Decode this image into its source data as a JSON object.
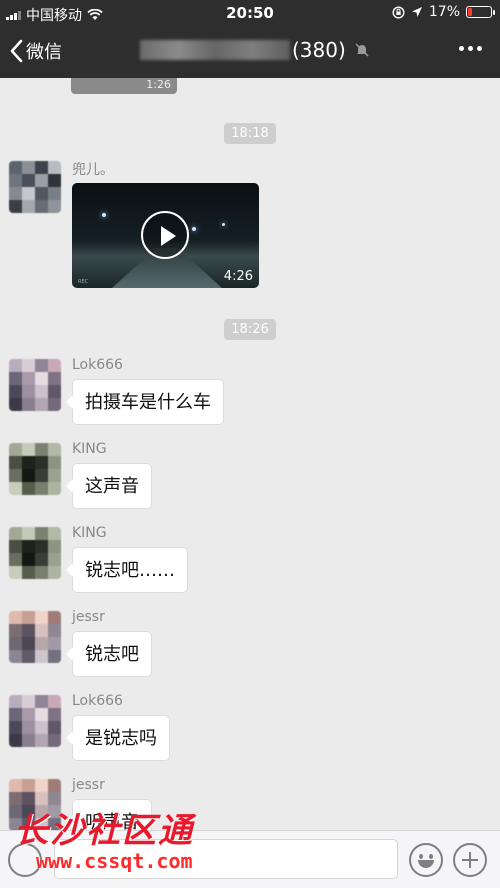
{
  "status_bar": {
    "carrier": "中国移动",
    "time": "20:50",
    "battery_percent": "17%",
    "battery_level": 0.17
  },
  "nav": {
    "back_label": "微信",
    "member_count": "(380)"
  },
  "chat": {
    "previous_duration": "1:26",
    "time_separators": [
      "18:18",
      "18:26"
    ],
    "video_message": {
      "sender": "兜儿。",
      "duration": "4:26"
    },
    "messages": [
      {
        "sender": "Lok666",
        "text": "拍摄车是什么车"
      },
      {
        "sender": "KING",
        "text": "这声音"
      },
      {
        "sender": "KING",
        "text": "锐志吧……"
      },
      {
        "sender": "jessr",
        "text": "锐志吧"
      },
      {
        "sender": "Lok666",
        "text": "是锐志吗"
      },
      {
        "sender": "jessr",
        "text": "听声音"
      }
    ]
  },
  "watermark": {
    "title": "长沙社区通",
    "url": "www.cssqt.com"
  },
  "icons": [
    "wifi-icon",
    "location-icon",
    "lock-rotation-icon",
    "mute-icon",
    "more-icon",
    "voice-icon",
    "emoji-icon",
    "plus-icon"
  ]
}
